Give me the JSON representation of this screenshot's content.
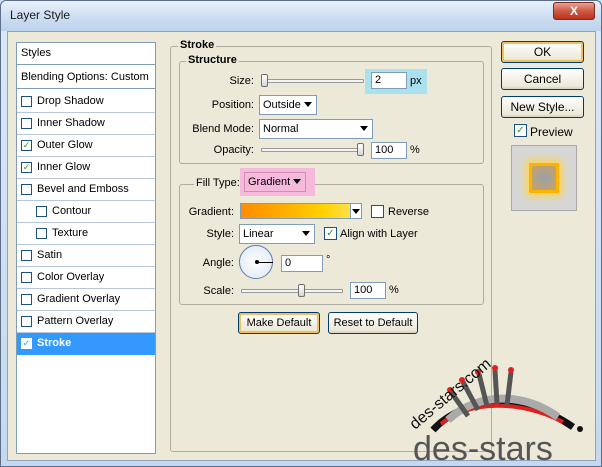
{
  "window": {
    "title": "Layer Style",
    "close_glyph": "X"
  },
  "stylelist": {
    "header": "Styles",
    "blending": "Blending Options: Custom",
    "items": [
      {
        "label": "Drop Shadow",
        "checked": false,
        "indent": false
      },
      {
        "label": "Inner Shadow",
        "checked": false,
        "indent": false
      },
      {
        "label": "Outer Glow",
        "checked": true,
        "indent": false
      },
      {
        "label": "Inner Glow",
        "checked": true,
        "indent": false
      },
      {
        "label": "Bevel and Emboss",
        "checked": false,
        "indent": false
      },
      {
        "label": "Contour",
        "checked": false,
        "indent": true
      },
      {
        "label": "Texture",
        "checked": false,
        "indent": true
      },
      {
        "label": "Satin",
        "checked": false,
        "indent": false
      },
      {
        "label": "Color Overlay",
        "checked": false,
        "indent": false
      },
      {
        "label": "Gradient Overlay",
        "checked": false,
        "indent": false
      },
      {
        "label": "Pattern Overlay",
        "checked": false,
        "indent": false
      },
      {
        "label": "Stroke",
        "checked": true,
        "indent": false,
        "selected": true
      }
    ]
  },
  "stroke": {
    "title": "Stroke",
    "structure": {
      "title": "Structure",
      "size_label": "Size:",
      "size_value": "2",
      "size_unit": "px",
      "position_label": "Position:",
      "position_value": "Outside",
      "blend_label": "Blend Mode:",
      "blend_value": "Normal",
      "opacity_label": "Opacity:",
      "opacity_value": "100",
      "opacity_unit": "%"
    },
    "fill": {
      "type_label": "Fill Type:",
      "type_value": "Gradient",
      "gradient_label": "Gradient:",
      "reverse_label": "Reverse",
      "reverse_checked": false,
      "style_label": "Style:",
      "style_value": "Linear",
      "align_label": "Align with Layer",
      "align_checked": true,
      "angle_label": "Angle:",
      "angle_value": "0",
      "angle_unit": "°",
      "scale_label": "Scale:",
      "scale_value": "100",
      "scale_unit": "%"
    },
    "make_default": "Make Default",
    "reset_default": "Reset to Default"
  },
  "buttons": {
    "ok": "OK",
    "cancel": "Cancel",
    "new_style": "New Style..."
  },
  "preview": {
    "label": "Preview",
    "checked": true
  },
  "watermark": {
    "text": "des-stars",
    "url_text": "des-stars.com"
  },
  "colors": {
    "selection": "#3399ff",
    "highlight_cyan": "#a9e2ee",
    "highlight_pink": "#f5b9dc",
    "gradient_start": "#ff8c00",
    "gradient_end": "#ffe14a"
  },
  "icons": [
    "close-icon",
    "chevron-down-icon",
    "check-icon",
    "angle-dial-icon"
  ]
}
